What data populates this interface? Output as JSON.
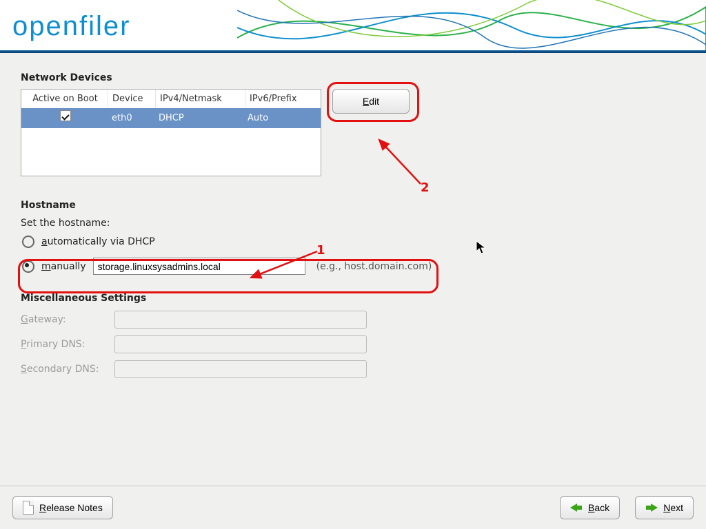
{
  "brand": "openfiler",
  "sections": {
    "network_devices": "Network Devices",
    "hostname": "Hostname",
    "misc": "Miscellaneous Settings"
  },
  "netdev": {
    "headers": {
      "active": "Active on Boot",
      "device": "Device",
      "ipv4": "IPv4/Netmask",
      "ipv6": "IPv6/Prefix"
    },
    "rows": [
      {
        "active": true,
        "device": "eth0",
        "ipv4": "DHCP",
        "ipv6": "Auto"
      }
    ],
    "edit_btn": "Edit",
    "edit_accesskey": "E"
  },
  "hostname": {
    "prompt": "Set the hostname:",
    "auto_label": "automatically via DHCP",
    "auto_accesskey": "a",
    "manual_label": "manually",
    "manual_accesskey": "m",
    "manual_value": "storage.linuxsysadmins.local",
    "manual_hint": "(e.g., host.domain.com)",
    "selected": "manual"
  },
  "misc": {
    "gateway": {
      "label": "Gateway:",
      "accesskey": "G",
      "value": ""
    },
    "primary": {
      "label": "Primary DNS:",
      "accesskey": "P",
      "value": ""
    },
    "secondary": {
      "label": "Secondary DNS:",
      "accesskey": "S",
      "value": ""
    }
  },
  "footer": {
    "release_notes": "Release Notes",
    "release_accesskey": "R",
    "back": "Back",
    "back_accesskey": "B",
    "next": "Next",
    "next_accesskey": "N"
  },
  "annotations": {
    "n1": "1",
    "n2": "2"
  }
}
